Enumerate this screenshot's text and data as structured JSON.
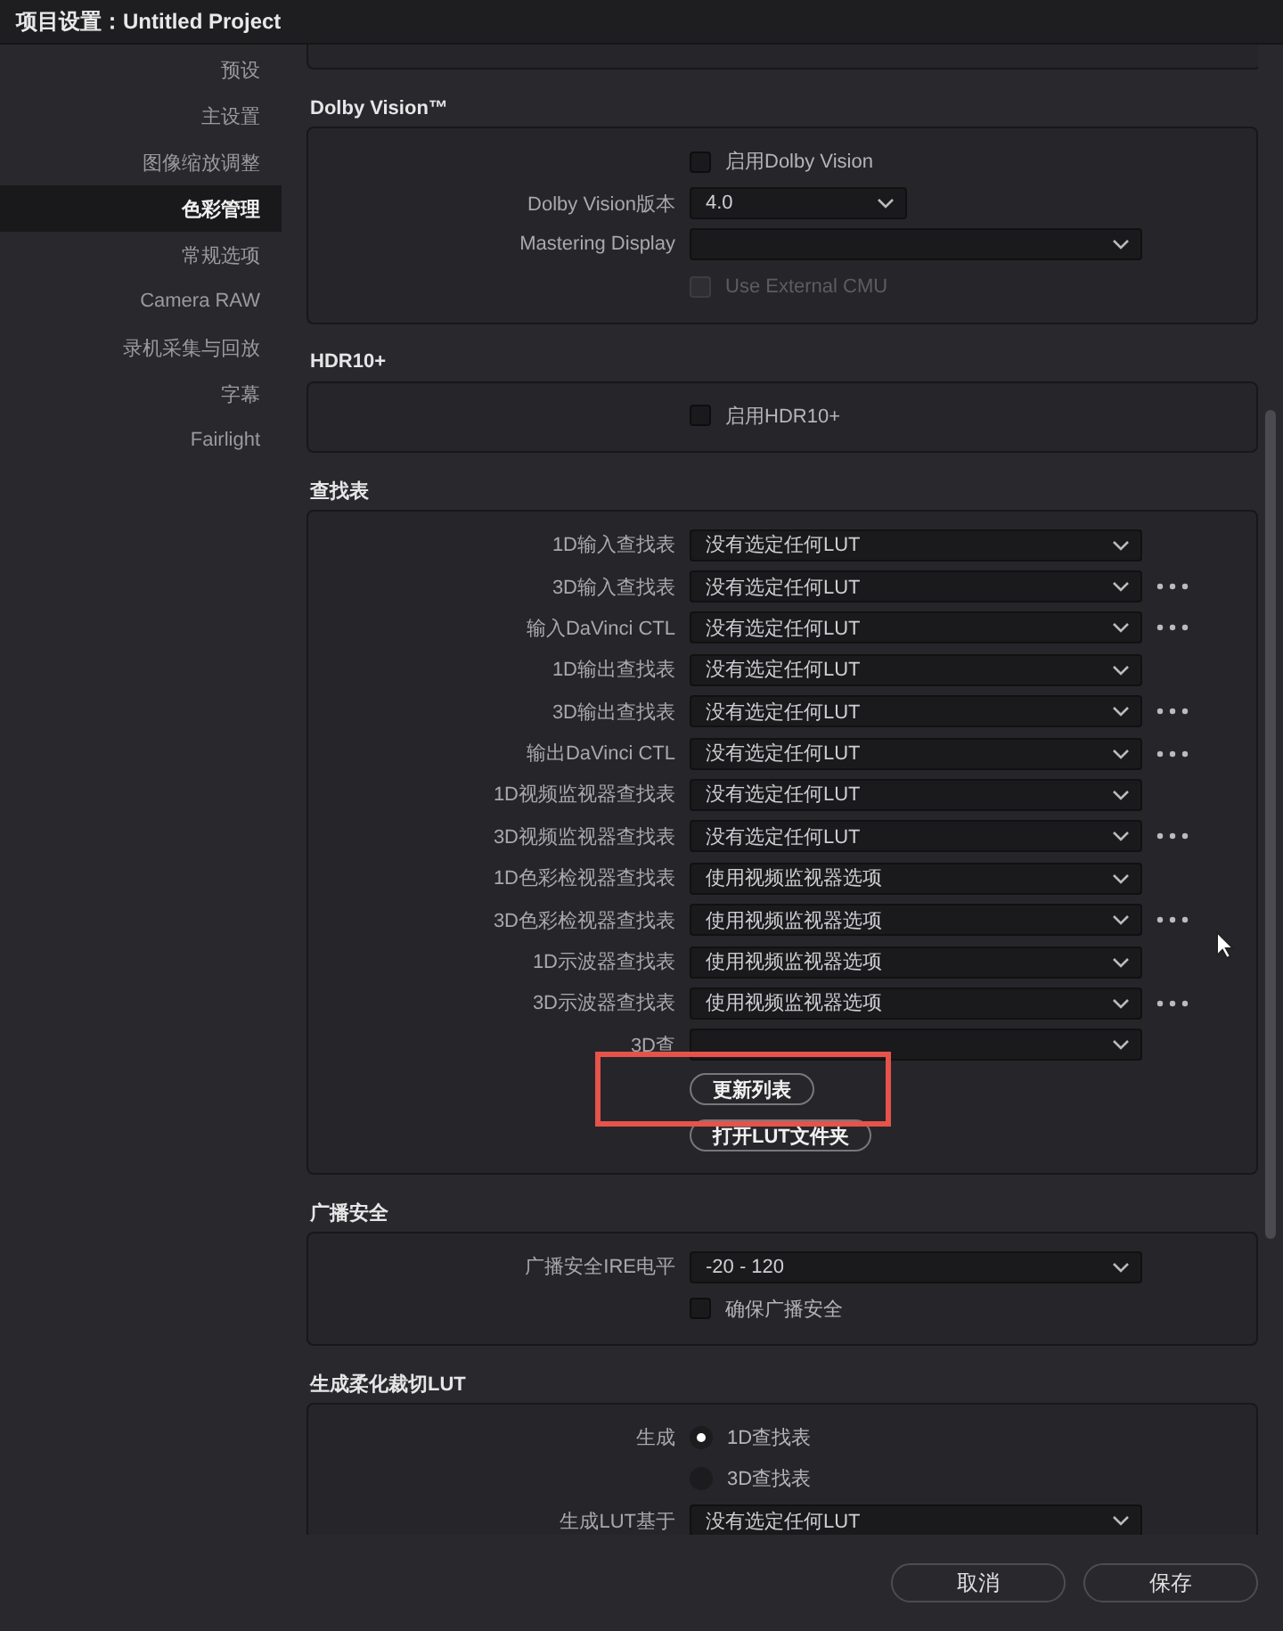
{
  "window": {
    "title": "项目设置：Untitled Project"
  },
  "sidebar": {
    "items": [
      {
        "label": "预设",
        "selected": false
      },
      {
        "label": "主设置",
        "selected": false
      },
      {
        "label": "图像缩放调整",
        "selected": false
      },
      {
        "label": "色彩管理",
        "selected": true
      },
      {
        "label": "常规选项",
        "selected": false
      },
      {
        "label": "Camera RAW",
        "selected": false
      },
      {
        "label": "录机采集与回放",
        "selected": false
      },
      {
        "label": "字幕",
        "selected": false
      },
      {
        "label": "Fairlight",
        "selected": false
      }
    ]
  },
  "sections": [
    {
      "title": "Dolby Vision™",
      "rows": [
        {
          "kind": "checkbox",
          "label": "启用Dolby Vision",
          "checked": false,
          "disabled": false
        },
        {
          "kind": "dropdown",
          "label": "Dolby Vision版本",
          "value": "4.0",
          "short": true,
          "more": false
        },
        {
          "kind": "dropdown",
          "label": "Mastering Display",
          "short": false,
          "more": false
        },
        {
          "kind": "checkbox",
          "label": "Use External CMU",
          "checked": false,
          "disabled": true
        }
      ]
    },
    {
      "title": "HDR10+",
      "rows": [
        {
          "kind": "checkbox",
          "label": "启用HDR10+",
          "checked": false,
          "disabled": false
        }
      ]
    },
    {
      "title": "查找表",
      "rows": [
        {
          "kind": "dropdown",
          "label": "1D输入查找表",
          "value": "没有选定任何LUT",
          "short": false,
          "more": false
        },
        {
          "kind": "dropdown",
          "label": "3D输入查找表",
          "value": "没有选定任何LUT",
          "short": false,
          "more": true
        },
        {
          "kind": "dropdown",
          "label": "输入DaVinci CTL",
          "value": "没有选定任何LUT",
          "short": false,
          "more": true
        },
        {
          "kind": "dropdown",
          "label": "1D输出查找表",
          "value": "没有选定任何LUT",
          "short": false,
          "more": false
        },
        {
          "kind": "dropdown",
          "label": "3D输出查找表",
          "value": "没有选定任何LUT",
          "short": false,
          "more": true
        },
        {
          "kind": "dropdown",
          "label": "输出DaVinci CTL",
          "value": "没有选定任何LUT",
          "short": false,
          "more": true
        },
        {
          "kind": "dropdown",
          "label": "1D视频监视器查找表",
          "value": "没有选定任何LUT",
          "short": false,
          "more": false
        },
        {
          "kind": "dropdown",
          "label": "3D视频监视器查找表",
          "value": "没有选定任何LUT",
          "short": false,
          "more": true
        },
        {
          "kind": "dropdown",
          "label": "1D色彩检视器查找表",
          "value": "使用视频监视器选项",
          "short": false,
          "more": false
        },
        {
          "kind": "dropdown",
          "label": "3D色彩检视器查找表",
          "value": "使用视频监视器选项",
          "short": false,
          "more": true
        },
        {
          "kind": "dropdown",
          "label": "1D示波器查找表",
          "value": "使用视频监视器选项",
          "short": false,
          "more": false
        },
        {
          "kind": "dropdown",
          "label": "3D示波器查找表",
          "value": "使用视频监视器选项",
          "short": false,
          "more": true
        },
        {
          "kind": "dropdown",
          "label": "3D查",
          "short": false,
          "more": false
        },
        {
          "kind": "button",
          "label": "更新列表",
          "highlighted": true
        },
        {
          "kind": "button",
          "label": "打开LUT文件夹",
          "highlighted": false
        }
      ]
    },
    {
      "title": "广播安全",
      "rows": [
        {
          "kind": "dropdown",
          "label": "广播安全IRE电平",
          "value": "-20 - 120",
          "short": false,
          "more": false
        },
        {
          "kind": "checkbox",
          "label": "确保广播安全",
          "checked": false,
          "disabled": false
        }
      ]
    },
    {
      "title": "生成柔化裁切LUT",
      "rows": [
        {
          "kind": "radio",
          "label": "生成",
          "options": [
            {
              "label": "1D查找表",
              "selected": true
            },
            {
              "label": "3D查找表",
              "selected": false
            }
          ]
        },
        {
          "kind": "dropdown",
          "label": "生成LUT基于",
          "value": "没有选定任何LUT",
          "short": false,
          "more": false
        }
      ]
    }
  ],
  "footer": {
    "buttons": [
      "取消",
      "保存"
    ]
  }
}
